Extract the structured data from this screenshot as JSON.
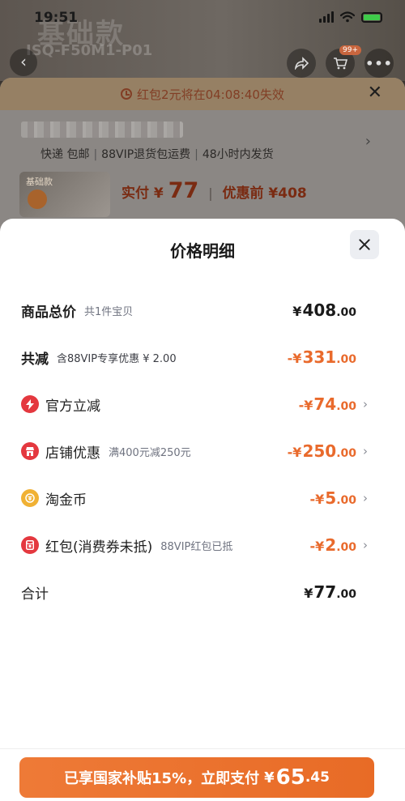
{
  "status": {
    "time": "19:51"
  },
  "background": {
    "title": "基础款",
    "model": "ISQ-F50M1-P01",
    "cart_badge": "99+"
  },
  "order_sheet": {
    "countdown_text": "红包2元将在04:08:40失效",
    "shipping": [
      "快递 包邮",
      "88VIP退货包运费",
      "48小时内发货"
    ],
    "thumb_text": "基础款",
    "actual_pay_label": "实付",
    "actual_pay_currency": "¥",
    "actual_pay_value": "77",
    "before_discount": "优惠前 ¥408"
  },
  "price_detail": {
    "title": "价格明细",
    "rows": [
      {
        "label": "商品总价",
        "sub": "共1件宝贝",
        "currency": "¥",
        "int": "408",
        "dec": ".00"
      },
      {
        "label": "共减",
        "sub": "含88VIP专享优惠 ¥ 2.00",
        "currency": "-¥",
        "int": "331",
        "dec": ".00"
      },
      {
        "label": "官方立减",
        "sub": "",
        "currency": "-¥",
        "int": "74",
        "dec": ".00",
        "icon": "lightning-icon"
      },
      {
        "label": "店铺优惠",
        "sub": "满400元减250元",
        "currency": "-¥",
        "int": "250",
        "dec": ".00",
        "icon": "store-icon"
      },
      {
        "label": "淘金币",
        "sub": "",
        "currency": "-¥",
        "int": "5",
        "dec": ".00",
        "icon": "coin-icon"
      },
      {
        "label": "红包(消费券未抵)",
        "sub": "88VIP红包已抵",
        "currency": "-¥",
        "int": "2",
        "dec": ".00",
        "icon": "red-packet-icon"
      },
      {
        "label": "合计",
        "sub": "",
        "currency": "¥",
        "int": "77",
        "dec": ".00"
      }
    ]
  },
  "pay_button": {
    "text": "已享国家补贴15%，立即支付",
    "currency": "¥",
    "int": "65",
    "dec": ".45"
  },
  "colors": {
    "accent": "#e96a2c",
    "button": "#ec7431",
    "icon_red": "#e4383f",
    "icon_gold": "#f0b134"
  }
}
